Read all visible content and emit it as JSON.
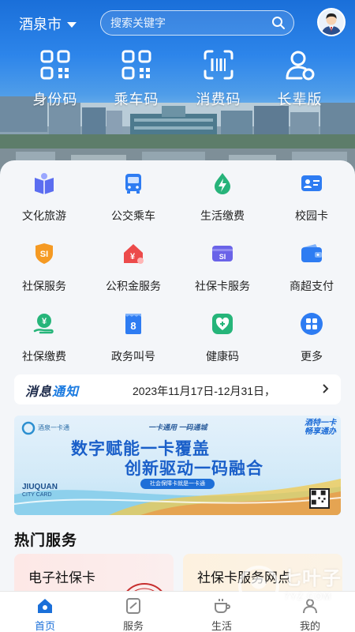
{
  "header": {
    "city": "酒泉市",
    "search_placeholder": "搜索关键字"
  },
  "quick_actions": [
    {
      "label": "身份码",
      "icon": "qr-code-icon"
    },
    {
      "label": "乘车码",
      "icon": "qr-code-icon"
    },
    {
      "label": "消费码",
      "icon": "scan-icon"
    },
    {
      "label": "长辈版",
      "icon": "user-icon"
    }
  ],
  "services": [
    {
      "label": "文化旅游",
      "icon": "book-icon"
    },
    {
      "label": "公交乘车",
      "icon": "bus-icon"
    },
    {
      "label": "生活缴费",
      "icon": "lightning-drop-icon"
    },
    {
      "label": "校园卡",
      "icon": "id-card-icon"
    },
    {
      "label": "社保服务",
      "icon": "social-security-shield-icon"
    },
    {
      "label": "公积金服务",
      "icon": "house-fund-icon"
    },
    {
      "label": "社保卡服务",
      "icon": "social-security-card-icon"
    },
    {
      "label": "商超支付",
      "icon": "wallet-icon"
    },
    {
      "label": "社保缴费",
      "icon": "yuan-hand-icon"
    },
    {
      "label": "政务叫号",
      "icon": "queue-number-icon"
    },
    {
      "label": "健康码",
      "icon": "health-code-icon"
    },
    {
      "label": "更多",
      "icon": "more-grid-icon"
    }
  ],
  "notice": {
    "tag_part1": "消息",
    "tag_part2": "通知",
    "text": "2023年11月17日-12月31日，"
  },
  "banner": {
    "logo_text": "酒泉一卡通",
    "small_text": "一卡通用 一码通城",
    "corner_text_1": "酒特一卡",
    "corner_text_2": "畅享通办",
    "title_1": "数字赋能一卡覆盖",
    "title_2": "创新驱动一码融合",
    "pill_text": "社会保障卡就是一卡通",
    "english_1": "JIUQUAN",
    "english_2": "CITY CARD"
  },
  "hot_services": {
    "title": "热门服务",
    "items": [
      {
        "label": "电子社保卡"
      },
      {
        "label": "社保卡服务网点"
      }
    ]
  },
  "bottom_nav": [
    {
      "label": "首页",
      "icon": "home-icon",
      "active": true
    },
    {
      "label": "服务",
      "icon": "service-icon",
      "active": false
    },
    {
      "label": "生活",
      "icon": "life-icon",
      "active": false
    },
    {
      "label": "我的",
      "icon": "profile-icon",
      "active": false
    }
  ],
  "watermark": {
    "text": "七叶子",
    "url": "7YZ.COM"
  },
  "colors": {
    "primary": "#1a6fd9",
    "text": "#222222"
  }
}
